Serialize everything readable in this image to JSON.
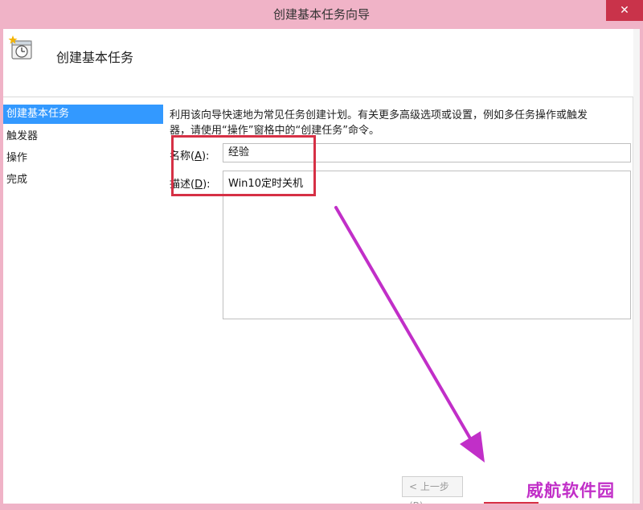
{
  "window": {
    "title": "创建基本任务向导",
    "close_glyph": "✕"
  },
  "header": {
    "title": "创建基本任务",
    "icon": "task-clock-icon"
  },
  "nav": {
    "items": [
      {
        "label": "创建基本任务",
        "active": true
      },
      {
        "label": "触发器",
        "active": false
      },
      {
        "label": "操作",
        "active": false
      },
      {
        "label": "完成",
        "active": false
      }
    ]
  },
  "content": {
    "intro_line1": "利用该向导快速地为常见任务创建计划。有关更多高级选项或设置，例如多任务操作或触发",
    "intro_line2": "器，请使用“操作”窗格中的“创建任务”命令。",
    "name_label_pre": "名称(",
    "name_label_key": "A",
    "name_label_post": "):",
    "name_value": "经验",
    "desc_label_pre": "描述(",
    "desc_label_key": "D",
    "desc_label_post": "):",
    "desc_value": "Win10定时关机"
  },
  "buttons": {
    "back_label": "< 上一步(B)"
  },
  "annotations": {
    "highlight_color": "#d63045",
    "arrow_color": "#c12fc8",
    "watermark": "威航软件园"
  },
  "colors": {
    "titlebar": "#f0b3c7",
    "nav_active": "#3399ff"
  }
}
